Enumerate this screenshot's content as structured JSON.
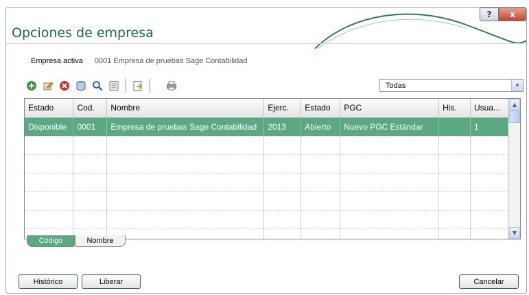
{
  "window": {
    "title": "Opciones de empresa",
    "help_label": "?",
    "close_label": "x"
  },
  "company": {
    "active_label": "Empresa activa",
    "active_value": "0001 Empresa de pruebas Sage Contabilidad"
  },
  "toolbar": {
    "icons": [
      "add-icon",
      "edit-icon",
      "delete-icon",
      "database-icon",
      "search-icon",
      "list-icon",
      "export-icon",
      "print-icon"
    ]
  },
  "filter": {
    "selected": "Todas"
  },
  "table": {
    "columns": [
      "Estado",
      "Cod.",
      "Nombre",
      "Ejerc.",
      "Estado",
      "PGC",
      "His.",
      "Usua..."
    ],
    "rows": [
      [
        "Disponible",
        "0001",
        "Empresa de pruebas Sage Contabilidad",
        "2013",
        "Abierto",
        "Nuevo PGC Estándar",
        "",
        "1"
      ]
    ]
  },
  "tabs": [
    "Código",
    "Nombre"
  ],
  "buttons": {
    "historico": "Histórico",
    "liberar": "Liberar",
    "cancelar": "Cancelar"
  },
  "colors": {
    "accent": "#5aa982",
    "title": "#1f6a4a"
  }
}
